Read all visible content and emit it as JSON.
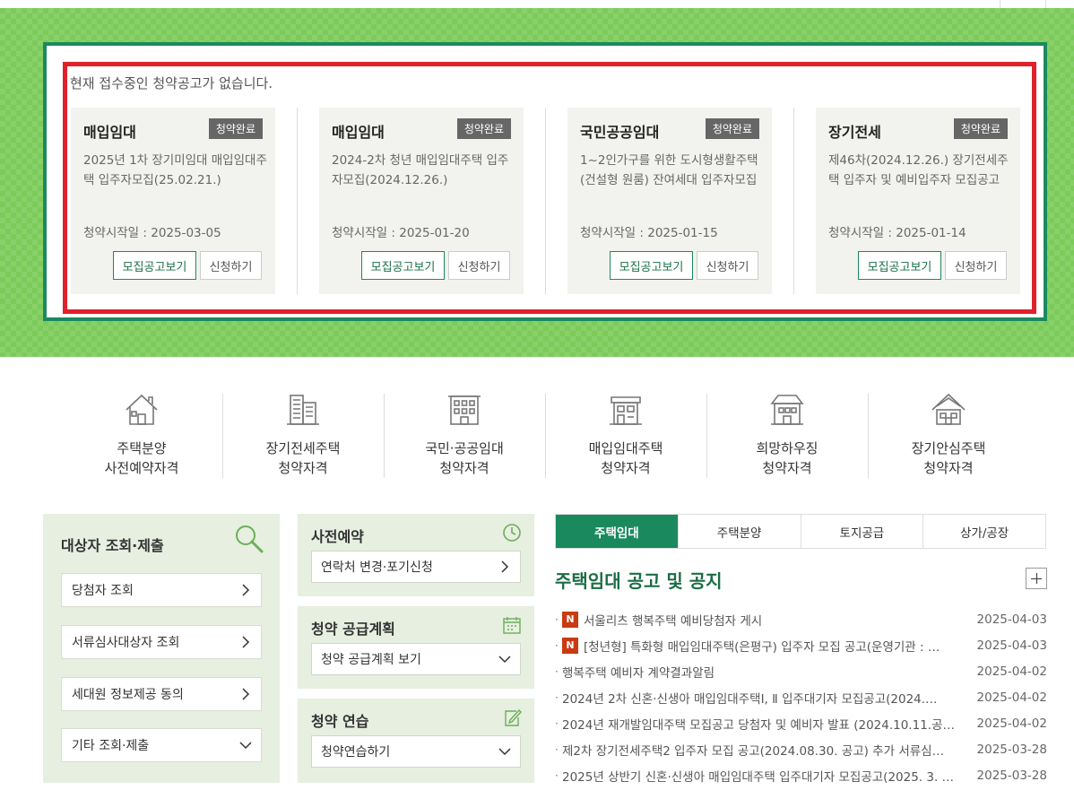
{
  "notice_text": "현재 접수중인 청약공고가 없습니다.",
  "cards": [
    {
      "category": "매입임대",
      "status": "청약완료",
      "title": "2025년 1차 장기미임대 매입임대주택 입주자모집(25.02.21.)",
      "start_date": "청약시작일 : 2025-03-05",
      "view_label": "모집공고보기",
      "apply_label": "신청하기"
    },
    {
      "category": "매입임대",
      "status": "청약완료",
      "title": "2024-2차 청년 매입임대주택 입주자모집(2024.12.26.)",
      "start_date": "청약시작일 : 2025-01-20",
      "view_label": "모집공고보기",
      "apply_label": "신청하기"
    },
    {
      "category": "국민공공임대",
      "status": "청약완료",
      "title": "1~2인가구를 위한 도시형생활주택(건설형 원룸) 잔여세대 입주자모집",
      "start_date": "청약시작일 : 2025-01-15",
      "view_label": "모집공고보기",
      "apply_label": "신청하기"
    },
    {
      "category": "장기전세",
      "status": "청약완료",
      "title": "제46차(2024.12.26.) 장기전세주택 입주자 및 예비입주자 모집공고",
      "start_date": "청약시작일 : 2025-01-14",
      "view_label": "모집공고보기",
      "apply_label": "신청하기"
    }
  ],
  "quick_menu": [
    {
      "line1": "주택분양",
      "line2": "사전예약자격",
      "icon": "house-icon"
    },
    {
      "line1": "장기전세주택",
      "line2": "청약자격",
      "icon": "apartment-icon"
    },
    {
      "line1": "국민·공공임대",
      "line2": "청약자격",
      "icon": "building-icon"
    },
    {
      "line1": "매입임대주택",
      "line2": "청약자격",
      "icon": "townhouse-icon"
    },
    {
      "line1": "희망하우징",
      "line2": "청약자격",
      "icon": "dormitory-icon"
    },
    {
      "line1": "장기안심주택",
      "line2": "청약자격",
      "icon": "home-icon"
    }
  ],
  "left_panel": {
    "title": "대상자 조회·제출",
    "items": [
      "당첨자 조회",
      "서류심사대상자 조회",
      "세대원 정보제공 동의",
      "기타 조회·제출"
    ]
  },
  "mid_panels": [
    {
      "title": "사전예약",
      "item": "연락처 변경·포기신청",
      "icon": "clock-icon"
    },
    {
      "title": "청약 공급계획",
      "item": "청약 공급계획 보기",
      "icon": "calendar-icon"
    },
    {
      "title": "청약 연습",
      "item": "청약연습하기",
      "icon": "edit-icon"
    }
  ],
  "tabs": [
    "주택임대",
    "주택분양",
    "토지공급",
    "상가/공장"
  ],
  "board_title": "주택임대 공고 및 공지",
  "notices": [
    {
      "new": true,
      "text": "서울리츠 행복주택 예비당첨자 게시",
      "date": "2025-04-03"
    },
    {
      "new": true,
      "text": "[청년형] 특화형 매입임대주택(은평구) 입주자 모집 공고(운영기관 : …",
      "date": "2025-04-03"
    },
    {
      "new": false,
      "text": "행복주택 예비자 계약결과알림",
      "date": "2025-04-02"
    },
    {
      "new": false,
      "text": "2024년 2차 신혼·신생아 매입임대주택Ⅰ, Ⅱ 입주대기자 모집공고(2024.…",
      "date": "2025-04-02"
    },
    {
      "new": false,
      "text": "2024년 재개발임대주택 모집공고 당첨자 및 예비자 발표 (2024.10.11.공…",
      "date": "2025-04-02"
    },
    {
      "new": false,
      "text": "제2차 장기전세주택2 입주자 모집 공고(2024.08.30. 공고) 추가 서류심…",
      "date": "2025-03-28"
    },
    {
      "new": false,
      "text": "2025년 상반기 신혼·신생아 매입임대주택 입주대기자 모집공고(2025. 3. …",
      "date": "2025-03-28"
    }
  ],
  "new_badge": "N"
}
